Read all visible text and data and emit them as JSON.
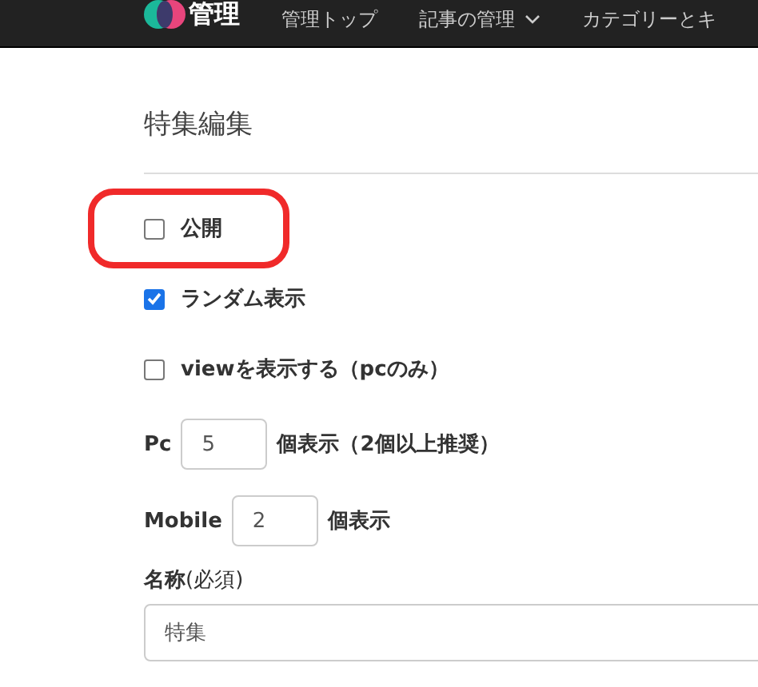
{
  "navbar": {
    "logo_text": "管理",
    "items": [
      {
        "label": "管理トップ",
        "has_menu": false
      },
      {
        "label": "記事の管理",
        "has_menu": true
      },
      {
        "label": "カテゴリーとキ",
        "has_menu": false
      }
    ]
  },
  "page_title": "特集編集",
  "options": [
    {
      "label": "公開",
      "checked": false,
      "highlighted": true
    },
    {
      "label": "ランダム表示",
      "checked": true,
      "highlighted": false
    },
    {
      "label": "viewを表示する（pcのみ）",
      "checked": false,
      "highlighted": false
    }
  ],
  "counts": [
    {
      "label": "Pc",
      "value": "5",
      "suffix": "個表示（2個以上推奨）"
    },
    {
      "label": "Mobile",
      "value": "2",
      "suffix": "個表示"
    }
  ],
  "name_field": {
    "label": "**名称**(必須)",
    "value": "特集"
  }
}
